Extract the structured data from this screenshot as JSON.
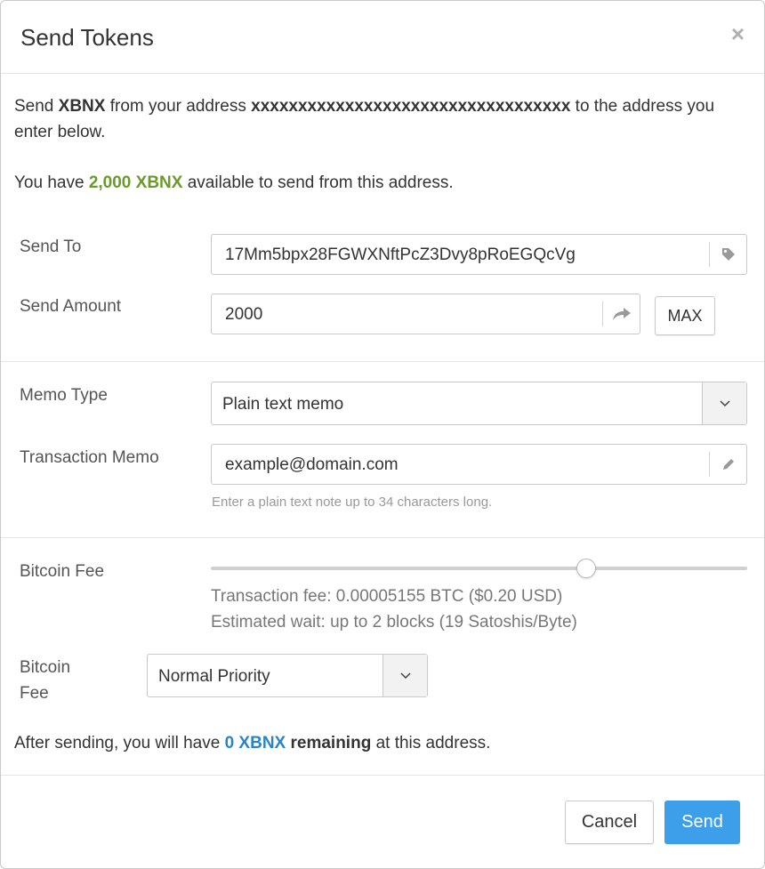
{
  "dialog": {
    "title": "Send Tokens",
    "close_glyph": "×"
  },
  "intro": {
    "part1": "Send ",
    "token": "XBNX",
    "part2": " from your address ",
    "address": "xxxxxxxxxxxxxxxxxxxxxxxxxxxxxxxxxx",
    "part3": " to the address you",
    "line2": "enter below."
  },
  "balance": {
    "prefix": "You have ",
    "amount": "2,000 XBNX",
    "suffix": " available to send from this address."
  },
  "form": {
    "send_to_label": "Send To",
    "send_to_value": "17Mm5bpx28FGWXNftPcZ3Dvy8pRoEGQcVg",
    "send_amount_label": "Send Amount",
    "send_amount_value": "2000",
    "max_button": "MAX",
    "memo_type_label": "Memo Type",
    "memo_type_value": "Plain text memo",
    "memo_label": "Transaction Memo",
    "memo_value": "example@domain.com",
    "memo_help": "Enter a plain text note up to 34 characters long."
  },
  "fee": {
    "label": "Bitcoin Fee",
    "slider_level": 0.7,
    "transaction_fee": "Transaction fee: 0.00005155 BTC ($0.20 USD)",
    "estimated_wait": "Estimated wait: up to 2 blocks (19 Satoshis/Byte)",
    "priority_label_line1": "Bitcoin",
    "priority_label_line2": "Fee",
    "priority_value": "Normal Priority"
  },
  "remaining": {
    "prefix": "After sending, you will have ",
    "amount": "0 XBNX",
    "bold": " remaining",
    "suffix": " at this address."
  },
  "footer": {
    "cancel_label": "Cancel",
    "send_label": "Send"
  },
  "colors": {
    "balance_green": "#6a9a2a",
    "remaining_blue": "#2a84c6",
    "send_button": "#3d9fe9"
  },
  "icons": [
    "tag-icon",
    "share-icon",
    "pencil-icon",
    "chevron-down-icon",
    "close-icon"
  ]
}
